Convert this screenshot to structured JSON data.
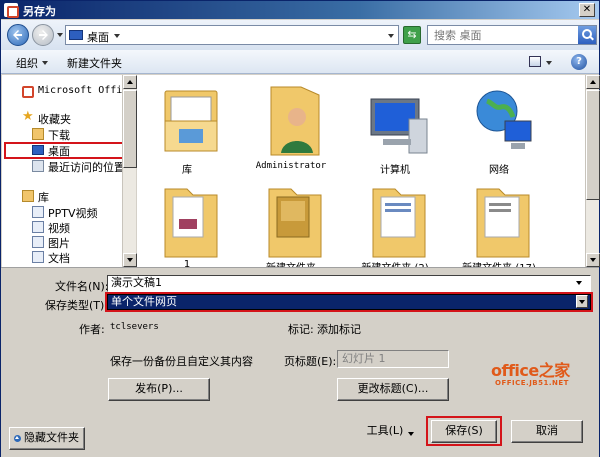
{
  "window": {
    "title": "另存为",
    "close": "✕"
  },
  "address_bar": {
    "location": "桌面",
    "search_placeholder": "搜索 桌面"
  },
  "toolbar": {
    "organize": "组织",
    "new_folder": "新建文件夹"
  },
  "nav_pane": {
    "items": [
      {
        "label": "Microsoft Office",
        "icon": "office-icon"
      },
      {
        "label": "收藏夹",
        "icon": "star-icon"
      },
      {
        "label": "下载",
        "icon": "folder-icon"
      },
      {
        "label": "桌面",
        "icon": "desktop-icon",
        "selected": true
      },
      {
        "label": "最近访问的位置",
        "icon": "recent-icon"
      },
      {
        "label": "库",
        "icon": "library-icon"
      },
      {
        "label": "PPTV视频",
        "icon": "video-icon"
      },
      {
        "label": "视频",
        "icon": "video-icon"
      },
      {
        "label": "图片",
        "icon": "picture-icon"
      },
      {
        "label": "文档",
        "icon": "document-icon"
      }
    ]
  },
  "files": [
    {
      "name": "库",
      "icon": "library-folder-icon"
    },
    {
      "name": "Administrator",
      "icon": "user-folder-icon"
    },
    {
      "name": "计算机",
      "icon": "computer-icon"
    },
    {
      "name": "网络",
      "icon": "network-icon"
    },
    {
      "name": "1",
      "icon": "folder-icon"
    },
    {
      "name": "新建文件夹",
      "icon": "folder-icon"
    },
    {
      "name": "新建文件夹 (2)",
      "icon": "folder-icon"
    },
    {
      "name": "新建文件夹 (17)",
      "icon": "folder-icon"
    }
  ],
  "form": {
    "filename_label": "文件名(N):",
    "filename_value": "演示文稿1",
    "savetype_label": "保存类型(T):",
    "savetype_value": "单个文件网页",
    "author_label": "作者:",
    "author_value": "tclsevers",
    "tags_label": "标记:",
    "tags_value": "添加标记",
    "savecopy_text": "保存一份备份且自定义其内容",
    "pagetitle_label": "页标题(E):",
    "pagetitle_value": "幻灯片 1",
    "publish_btn": "发布(P)...",
    "changetitle_btn": "更改标题(C)...",
    "hide_folders_btn": "隐藏文件夹",
    "tools_btn": "工具(L)",
    "save_btn": "保存(S)",
    "cancel_btn": "取消"
  },
  "watermark": {
    "logo": "office之家",
    "url": "OFFICE.JB51.NET"
  },
  "colors": {
    "highlight_red": "#d4141a",
    "selection_navy": "#0a246a",
    "watermark_orange": "#e05a1a"
  }
}
